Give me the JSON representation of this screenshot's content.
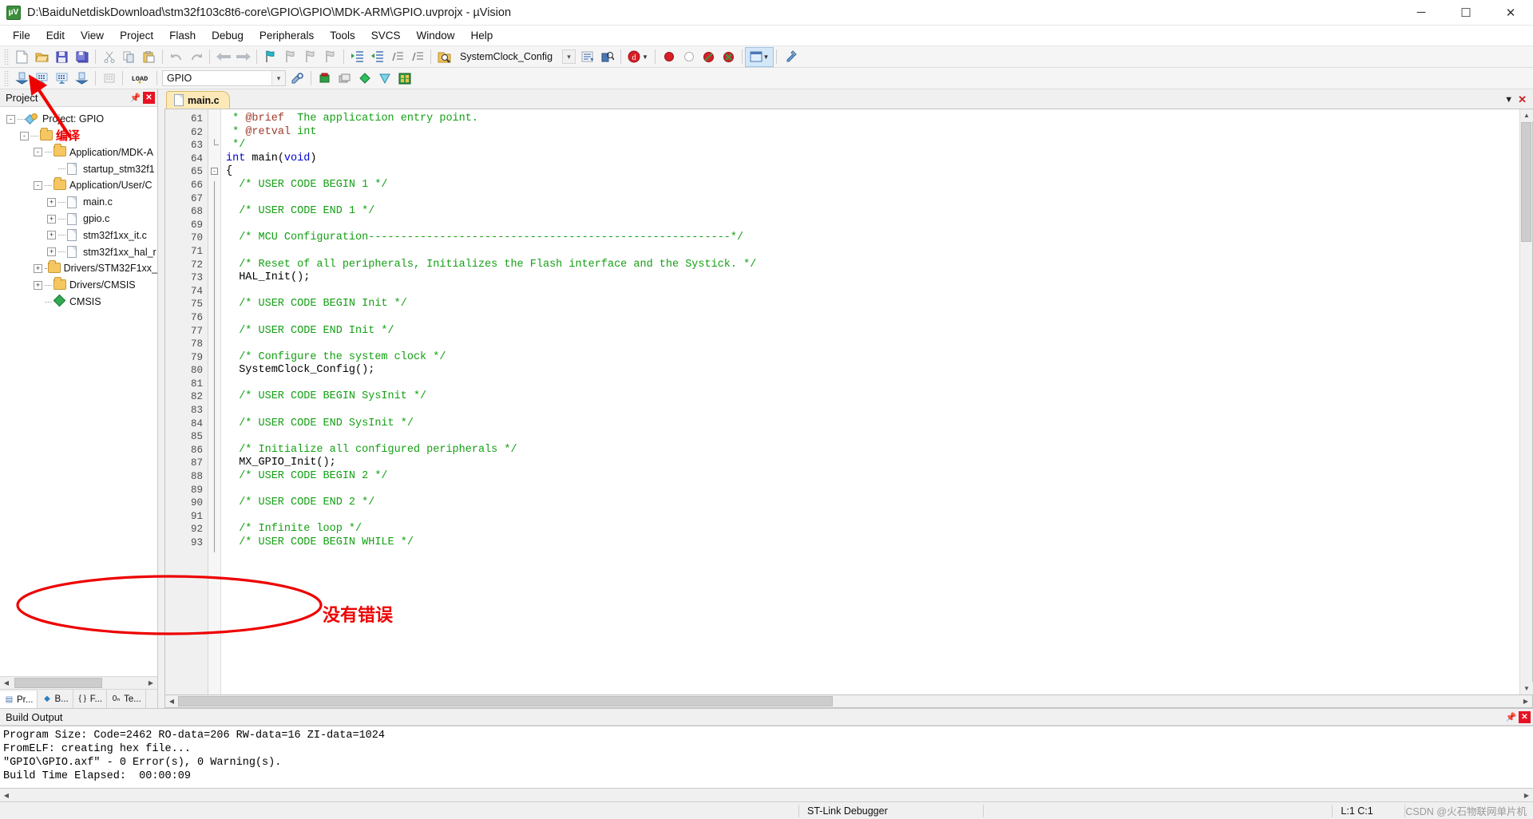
{
  "window": {
    "title": "D:\\BaiduNetdiskDownload\\stm32f103c8t6-core\\GPIO\\GPIO\\MDK-ARM\\GPIO.uvprojx - µVision",
    "app_icon": "uvision-icon",
    "minimize": "─",
    "maximize": "☐",
    "close": "✕"
  },
  "menu": {
    "items": [
      "File",
      "Edit",
      "View",
      "Project",
      "Flash",
      "Debug",
      "Peripherals",
      "Tools",
      "SVCS",
      "Window",
      "Help"
    ]
  },
  "toolbar_main": {
    "target_combo_value": "SystemClock_Config",
    "buttons": [
      {
        "name": "new-file-icon",
        "glyph": "🗋"
      },
      {
        "name": "open-file-icon",
        "glyph": "📂"
      },
      {
        "name": "save-icon",
        "glyph": "💾"
      },
      {
        "name": "save-all-icon",
        "glyph": "🖫"
      },
      {
        "name": "cut-icon",
        "glyph": "✂"
      },
      {
        "name": "copy-icon",
        "glyph": "❐"
      },
      {
        "name": "paste-icon",
        "glyph": "📋"
      },
      {
        "name": "undo-icon",
        "glyph": "↶"
      },
      {
        "name": "redo-icon",
        "glyph": "↷"
      },
      {
        "name": "navigate-back-icon",
        "glyph": "←"
      },
      {
        "name": "navigate-forward-icon",
        "glyph": "→"
      },
      {
        "name": "toggle-bookmark-icon",
        "glyph": "⚑"
      },
      {
        "name": "previous-bookmark-icon",
        "glyph": "⚑"
      },
      {
        "name": "next-bookmark-icon",
        "glyph": "⚑"
      },
      {
        "name": "clear-bookmarks-icon",
        "glyph": "⚑"
      },
      {
        "name": "indent-icon",
        "glyph": "⇥"
      },
      {
        "name": "outdent-icon",
        "glyph": "⇤"
      },
      {
        "name": "comment-icon",
        "glyph": "≡"
      },
      {
        "name": "uncomment-icon",
        "glyph": "≡"
      },
      {
        "name": "find-in-files-icon",
        "glyph": "🔍"
      },
      {
        "name": "function-list-icon",
        "glyph": "⌄"
      },
      {
        "name": "bookmark-list-icon",
        "glyph": "🗒"
      },
      {
        "name": "find-icon",
        "glyph": "🔎"
      },
      {
        "name": "debug-session-icon",
        "glyph": "ⓓ"
      },
      {
        "name": "breakpoint-icon",
        "glyph": "●"
      },
      {
        "name": "breakpoint-disable-icon",
        "glyph": "○"
      },
      {
        "name": "breakpoint-disable-all-icon",
        "glyph": "⊘"
      },
      {
        "name": "breakpoint-kill-all-icon",
        "glyph": "⊗"
      },
      {
        "name": "window-layout-icon",
        "glyph": "▤"
      },
      {
        "name": "configure-icon",
        "glyph": "🔧"
      }
    ]
  },
  "toolbar_build": {
    "target_value": "GPIO",
    "buttons": [
      {
        "name": "translate-file-icon",
        "glyph": "⬇"
      },
      {
        "name": "build-target-icon",
        "glyph": "▒"
      },
      {
        "name": "rebuild-all-icon",
        "glyph": "▓"
      },
      {
        "name": "batch-build-icon",
        "glyph": "⬆"
      },
      {
        "name": "stop-build-icon",
        "glyph": "▦"
      },
      {
        "name": "download-icon",
        "glyph": "LOAD"
      },
      {
        "name": "target-options-icon",
        "glyph": "⚙"
      },
      {
        "name": "manage-run-time-env-icon",
        "glyph": "◆"
      },
      {
        "name": "select-software-packs-icon",
        "glyph": "▽"
      },
      {
        "name": "pack-installer-icon",
        "glyph": "▨"
      },
      {
        "name": "multi-project-icon",
        "glyph": "▣"
      }
    ]
  },
  "project_panel": {
    "title": "Project",
    "pin_icon": "pin-icon",
    "close_icon": "close-icon",
    "tree": [
      {
        "depth": 0,
        "expander": "-",
        "icon": "project-icon",
        "label": "Project: GPIO"
      },
      {
        "depth": 1,
        "expander": "-",
        "icon": "target-folder-icon",
        "label": "编译",
        "red": true
      },
      {
        "depth": 2,
        "expander": "-",
        "icon": "folder-icon",
        "label": "Application/MDK-A"
      },
      {
        "depth": 3,
        "expander": "",
        "icon": "file-icon",
        "label": "startup_stm32f1"
      },
      {
        "depth": 2,
        "expander": "-",
        "icon": "folder-icon",
        "label": "Application/User/C"
      },
      {
        "depth": 3,
        "expander": "+",
        "icon": "file-icon",
        "label": "main.c"
      },
      {
        "depth": 3,
        "expander": "+",
        "icon": "file-icon",
        "label": "gpio.c"
      },
      {
        "depth": 3,
        "expander": "+",
        "icon": "file-icon",
        "label": "stm32f1xx_it.c"
      },
      {
        "depth": 3,
        "expander": "+",
        "icon": "file-icon",
        "label": "stm32f1xx_hal_r"
      },
      {
        "depth": 2,
        "expander": "+",
        "icon": "folder-icon",
        "label": "Drivers/STM32F1xx_"
      },
      {
        "depth": 2,
        "expander": "+",
        "icon": "folder-icon",
        "label": "Drivers/CMSIS"
      },
      {
        "depth": 2,
        "expander": "",
        "icon": "cmsis-icon",
        "label": "CMSIS"
      }
    ],
    "tabs": [
      {
        "label": "Pr...",
        "icon": "project-tab-icon",
        "active": true
      },
      {
        "label": "B...",
        "icon": "books-tab-icon",
        "active": false
      },
      {
        "label": "F...",
        "icon": "functions-tab-icon",
        "active": false
      },
      {
        "label": "Te...",
        "icon": "templates-tab-icon",
        "active": false
      }
    ]
  },
  "editor": {
    "tabs": [
      {
        "label": "main.c",
        "icon": "file-icon",
        "active": true
      }
    ],
    "minimize_glyph": "▼",
    "close_glyph": "✕",
    "first_line_number": 61,
    "lines": [
      {
        "n": 61,
        "segments": [
          {
            "t": " * ",
            "c": "cm"
          },
          {
            "t": "@brief",
            "c": "dr"
          },
          {
            "t": "  The application entry point.",
            "c": "cm"
          }
        ]
      },
      {
        "n": 62,
        "segments": [
          {
            "t": " * ",
            "c": "cm"
          },
          {
            "t": "@retval",
            "c": "dr"
          },
          {
            "t": " int",
            "c": "cm"
          }
        ]
      },
      {
        "n": 63,
        "segments": [
          {
            "t": " */",
            "c": "cm"
          }
        ]
      },
      {
        "n": 64,
        "segments": [
          {
            "t": "int",
            "c": "kw"
          },
          {
            "t": " main(",
            "c": ""
          },
          {
            "t": "void",
            "c": "kw"
          },
          {
            "t": ")",
            "c": ""
          }
        ]
      },
      {
        "n": 65,
        "segments": [
          {
            "t": "{",
            "c": ""
          }
        ],
        "fold": "box"
      },
      {
        "n": 66,
        "segments": [
          {
            "t": "  /* USER CODE BEGIN 1 */",
            "c": "cm"
          }
        ]
      },
      {
        "n": 67,
        "segments": [
          {
            "t": "",
            "c": ""
          }
        ]
      },
      {
        "n": 68,
        "segments": [
          {
            "t": "  /* USER CODE END 1 */",
            "c": "cm"
          }
        ]
      },
      {
        "n": 69,
        "segments": [
          {
            "t": "",
            "c": ""
          }
        ]
      },
      {
        "n": 70,
        "segments": [
          {
            "t": "  /* MCU Configuration--------------------------------------------------------*/",
            "c": "cm"
          }
        ]
      },
      {
        "n": 71,
        "segments": [
          {
            "t": "",
            "c": ""
          }
        ]
      },
      {
        "n": 72,
        "segments": [
          {
            "t": "  /* Reset of all peripherals, Initializes the Flash interface and the Systick. */",
            "c": "cm"
          }
        ]
      },
      {
        "n": 73,
        "segments": [
          {
            "t": "  HAL_Init();",
            "c": ""
          }
        ]
      },
      {
        "n": 74,
        "segments": [
          {
            "t": "",
            "c": ""
          }
        ]
      },
      {
        "n": 75,
        "segments": [
          {
            "t": "  /* USER CODE BEGIN Init */",
            "c": "cm"
          }
        ]
      },
      {
        "n": 76,
        "segments": [
          {
            "t": "",
            "c": ""
          }
        ]
      },
      {
        "n": 77,
        "segments": [
          {
            "t": "  /* USER CODE END Init */",
            "c": "cm"
          }
        ]
      },
      {
        "n": 78,
        "segments": [
          {
            "t": "",
            "c": ""
          }
        ]
      },
      {
        "n": 79,
        "segments": [
          {
            "t": "  /* Configure the system clock */",
            "c": "cm"
          }
        ]
      },
      {
        "n": 80,
        "segments": [
          {
            "t": "  SystemClock_Config();",
            "c": ""
          }
        ]
      },
      {
        "n": 81,
        "segments": [
          {
            "t": "",
            "c": ""
          }
        ]
      },
      {
        "n": 82,
        "segments": [
          {
            "t": "  /* USER CODE BEGIN SysInit */",
            "c": "cm"
          }
        ]
      },
      {
        "n": 83,
        "segments": [
          {
            "t": "",
            "c": ""
          }
        ]
      },
      {
        "n": 84,
        "segments": [
          {
            "t": "  /* USER CODE END SysInit */",
            "c": "cm"
          }
        ]
      },
      {
        "n": 85,
        "segments": [
          {
            "t": "",
            "c": ""
          }
        ]
      },
      {
        "n": 86,
        "segments": [
          {
            "t": "  /* Initialize all configured peripherals */",
            "c": "cm"
          }
        ]
      },
      {
        "n": 87,
        "segments": [
          {
            "t": "  MX_GPIO_Init();",
            "c": ""
          }
        ]
      },
      {
        "n": 88,
        "segments": [
          {
            "t": "  /* USER CODE BEGIN 2 */",
            "c": "cm"
          }
        ]
      },
      {
        "n": 89,
        "segments": [
          {
            "t": "",
            "c": ""
          }
        ]
      },
      {
        "n": 90,
        "segments": [
          {
            "t": "  /* USER CODE END 2 */",
            "c": "cm"
          }
        ]
      },
      {
        "n": 91,
        "segments": [
          {
            "t": "",
            "c": ""
          }
        ]
      },
      {
        "n": 92,
        "segments": [
          {
            "t": "  /* Infinite loop */",
            "c": "cm"
          }
        ]
      },
      {
        "n": 93,
        "segments": [
          {
            "t": "  /* USER CODE BEGIN WHILE */",
            "c": "cm"
          }
        ]
      }
    ]
  },
  "build_output": {
    "title": "Build Output",
    "pin_icon": "pin-icon",
    "close_icon": "close-icon",
    "lines": [
      "Program Size: Code=2462 RO-data=206 RW-data=16 ZI-data=1024",
      "FromELF: creating hex file...",
      "\"GPIO\\GPIO.axf\" - 0 Error(s), 0 Warning(s).",
      "Build Time Elapsed:  00:00:09"
    ]
  },
  "annotations": {
    "compile_label": "编译",
    "no_error_label": "没有错误",
    "color": "#ee0000"
  },
  "statusbar": {
    "debugger": "ST-Link Debugger",
    "cursor": "L:1 C:1",
    "watermark": "CSDN @火石物联网单片机"
  }
}
